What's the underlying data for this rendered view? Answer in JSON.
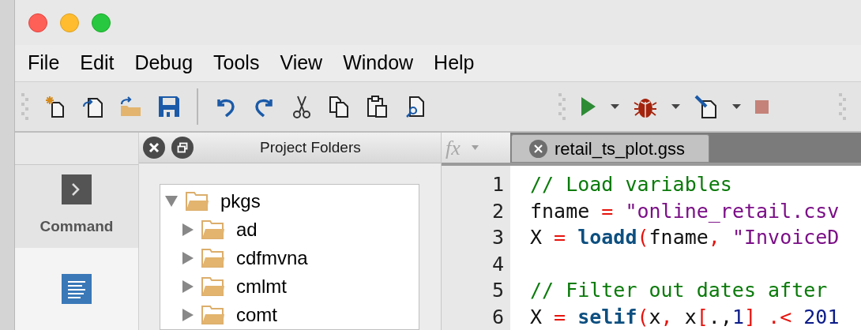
{
  "menu": [
    "File",
    "Edit",
    "Debug",
    "Tools",
    "View",
    "Window",
    "Help"
  ],
  "sidebar": {
    "items": [
      {
        "label": "Command",
        "selected": true
      },
      {
        "selected": false
      }
    ]
  },
  "project_panel": {
    "title": "Project Folders",
    "tree": [
      {
        "label": "pkgs",
        "expanded": true,
        "children": [
          {
            "label": "ad",
            "expanded": false
          },
          {
            "label": "cdfmvna",
            "expanded": false
          },
          {
            "label": "cmlmt",
            "expanded": false
          },
          {
            "label": "comt",
            "expanded": false
          }
        ]
      }
    ]
  },
  "editor": {
    "fx_button": {
      "label": "fx"
    },
    "tabs": [
      {
        "label": "retail_ts_plot.gss",
        "selected": true
      }
    ],
    "lines": [
      {
        "number": "1",
        "tokens": [
          {
            "kind": "comment",
            "text": "// Load variables"
          }
        ]
      },
      {
        "number": "2",
        "tokens": [
          {
            "kind": "plain",
            "text": "fname"
          },
          {
            "kind": "op",
            "text": " = "
          },
          {
            "kind": "string",
            "text": "\"online_retail.csv"
          }
        ]
      },
      {
        "number": "3",
        "tokens": [
          {
            "kind": "plain",
            "text": "X"
          },
          {
            "kind": "op",
            "text": " = "
          },
          {
            "kind": "func",
            "text": "loadd"
          },
          {
            "kind": "op",
            "text": "("
          },
          {
            "kind": "plain",
            "text": "fname"
          },
          {
            "kind": "op",
            "text": ", "
          },
          {
            "kind": "string",
            "text": "\"InvoiceD"
          }
        ]
      },
      {
        "number": "4"
      },
      {
        "number": "5",
        "tokens": [
          {
            "kind": "comment",
            "text": "// Filter out dates after"
          }
        ]
      },
      {
        "number": "6",
        "tokens": [
          {
            "kind": "plain",
            "text": "X"
          },
          {
            "kind": "op",
            "text": " = "
          },
          {
            "kind": "func",
            "text": "selif"
          },
          {
            "kind": "op",
            "text": "("
          },
          {
            "kind": "plain",
            "text": "x"
          },
          {
            "kind": "op",
            "text": ", "
          },
          {
            "kind": "plain",
            "text": "x"
          },
          {
            "kind": "op",
            "text": "["
          },
          {
            "kind": "plain",
            "text": ".,"
          },
          {
            "kind": "number",
            "text": "1"
          },
          {
            "kind": "op",
            "text": "]"
          },
          {
            "kind": "op",
            "text": " .< "
          },
          {
            "kind": "number",
            "text": "201"
          }
        ]
      }
    ]
  }
}
